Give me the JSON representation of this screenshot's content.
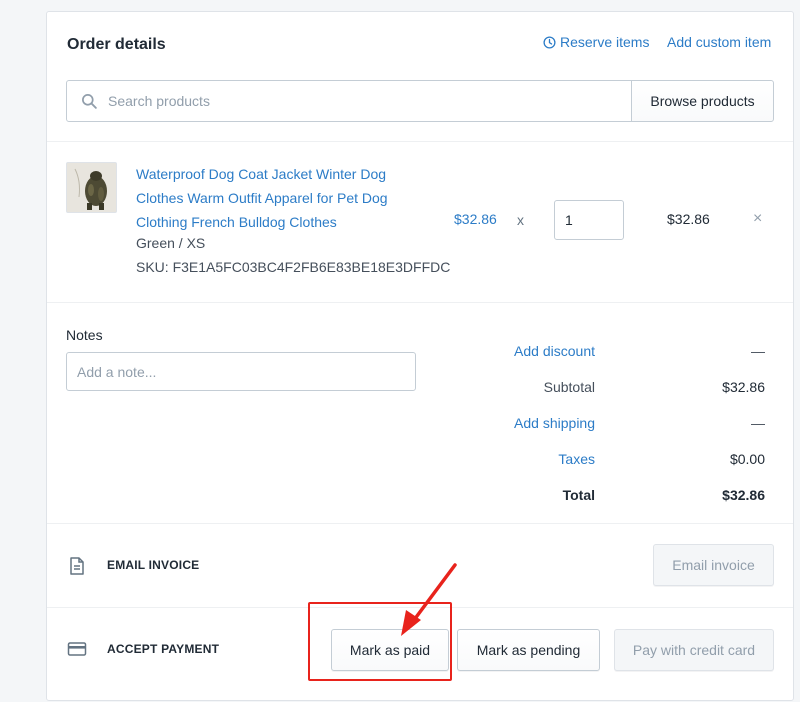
{
  "header": {
    "title": "Order details",
    "reserve_items": "Reserve items",
    "add_custom_item": "Add custom item"
  },
  "search": {
    "placeholder": "Search products",
    "browse_label": "Browse products"
  },
  "line_item": {
    "title": "Waterproof Dog Coat Jacket Winter Dog Clothes Warm Outfit Apparel for Pet Dog Clothing French Bulldog Clothes",
    "variant": "Green / XS",
    "sku": "SKU: F3E1A5FC03BC4F2FB6E83BE18E3DFFDC",
    "unit_price": "$32.86",
    "times": "x",
    "quantity": "1",
    "line_total": "$32.86",
    "remove": "×"
  },
  "notes": {
    "label": "Notes",
    "placeholder": "Add a note..."
  },
  "summary": {
    "discount_label": "Add discount",
    "discount_value": "—",
    "subtotal_label": "Subtotal",
    "subtotal_value": "$32.86",
    "shipping_label": "Add shipping",
    "shipping_value": "—",
    "taxes_label": "Taxes",
    "taxes_value": "$0.00",
    "total_label": "Total",
    "total_value": "$32.86"
  },
  "email_invoice": {
    "title": "EMAIL INVOICE",
    "button": "Email invoice"
  },
  "accept_payment": {
    "title": "ACCEPT PAYMENT",
    "mark_paid": "Mark as paid",
    "mark_pending": "Mark as pending",
    "pay_credit": "Pay with credit card"
  },
  "colors": {
    "link": "#2c7cc7",
    "annotation": "#e8231c"
  },
  "icons": [
    "clock-icon",
    "search-icon",
    "close-icon",
    "document-icon",
    "credit-card-icon"
  ]
}
